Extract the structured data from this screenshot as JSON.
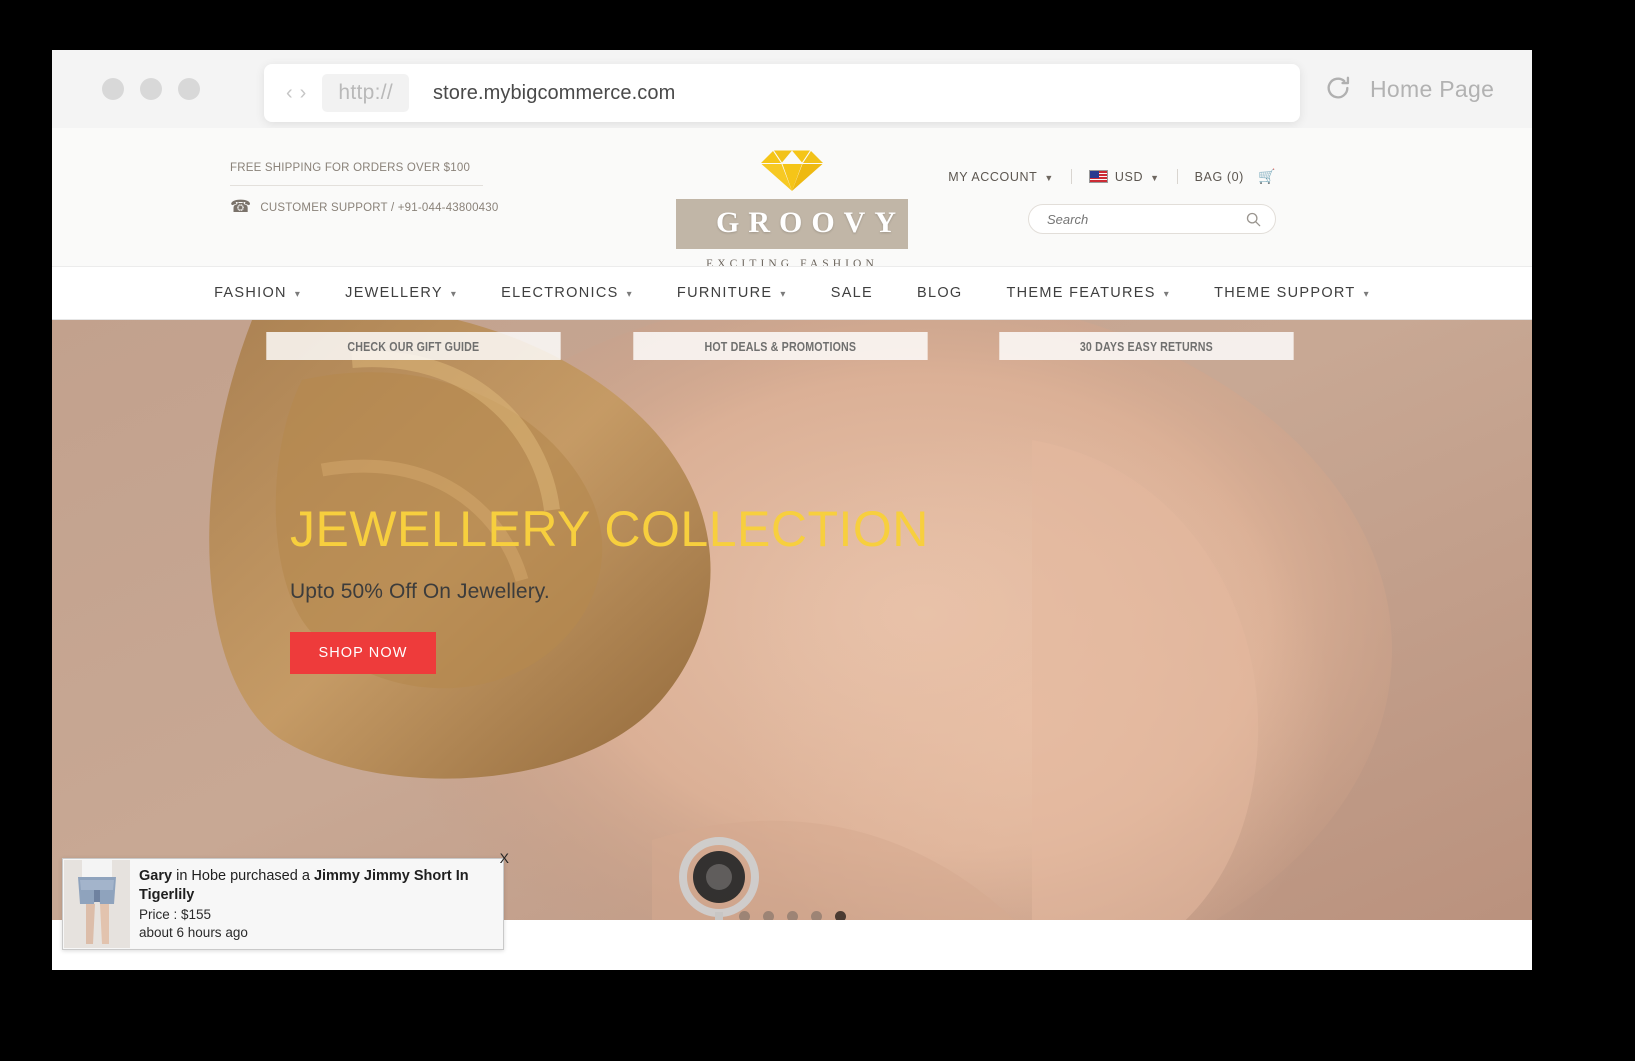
{
  "browser": {
    "url_protocol": "http://",
    "url": "store.mybigcommerce.com",
    "page_title": "Home Page",
    "back_arrow": "‹",
    "forward_arrow": "›"
  },
  "store_header": {
    "free_shipping": "FREE SHIPPING FOR ORDERS OVER $100",
    "customer_support": "CUSTOMER SUPPORT / +91-044-43800430",
    "logo_name": "GROOVY",
    "logo_tagline": "EXCITING FASHION",
    "logo_diamond_color": "#f5c518",
    "logo_bar_color": "#c1b6a7",
    "my_account": "MY ACCOUNT",
    "currency": "USD",
    "bag": "BAG (0)",
    "search_placeholder": "Search",
    "search_value": ""
  },
  "nav": {
    "items": [
      {
        "label": "FASHION",
        "has_dropdown": true
      },
      {
        "label": "JEWELLERY",
        "has_dropdown": true
      },
      {
        "label": "ELECTRONICS",
        "has_dropdown": true
      },
      {
        "label": "FURNITURE",
        "has_dropdown": true
      },
      {
        "label": "SALE",
        "has_dropdown": false
      },
      {
        "label": "BLOG",
        "has_dropdown": false
      },
      {
        "label": "THEME FEATURES",
        "has_dropdown": true
      },
      {
        "label": "THEME SUPPORT",
        "has_dropdown": true
      }
    ]
  },
  "promo_buttons": [
    "CHECK OUR GIFT GUIDE",
    "HOT DEALS & PROMOTIONS",
    "30 DAYS EASY RETURNS"
  ],
  "hero": {
    "title": "JEWELLERY COLLECTION",
    "subtitle": "Upto 50% Off On Jewellery.",
    "cta": "SHOP NOW",
    "cta_color": "#ee3b3b",
    "title_color": "#f7cf3e",
    "slide_count": 5,
    "active_slide": 5
  },
  "notification": {
    "buyer": "Gary",
    "text_middle": " in Hobe purchased a ",
    "product": "Jimmy Jimmy Short In Tigerlily",
    "price": "Price : $155",
    "time": "about 6 hours ago",
    "close_label": "X"
  }
}
